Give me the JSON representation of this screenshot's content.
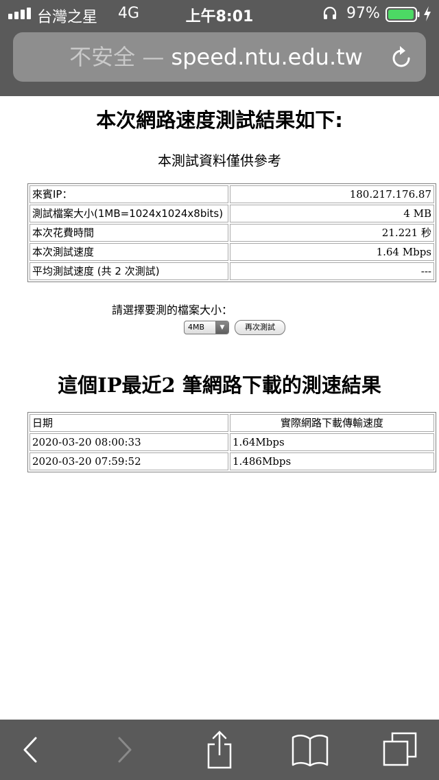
{
  "status_bar": {
    "carrier": "台灣之星",
    "network": "4G",
    "time": "上午8:01",
    "battery_percent": "97%",
    "battery_level": 0.97,
    "icons": [
      "signal-icon",
      "headphone-icon",
      "battery-icon",
      "charging-bolt-icon"
    ]
  },
  "url_bar": {
    "security_label": "不安全 —",
    "domain": "speed.ntu.edu.tw",
    "reload_icon": "reload-icon"
  },
  "page": {
    "title": "本次網路速度測試結果如下:",
    "subtitle": "本測試資料僅供參考",
    "results": [
      {
        "label": "來賓IP：",
        "value": "180.217.176.87"
      },
      {
        "label": "測試檔案大小(1MB=1024x1024x8bits)",
        "value": "4 MB"
      },
      {
        "label": "本次花費時間",
        "value": "21.221 秒"
      },
      {
        "label": "本次測試速度",
        "value": "1.64 Mbps"
      },
      {
        "label": "平均測試速度 (共 2 次測試)",
        "value": "---"
      }
    ],
    "select_label": "請選擇要測的檔案大小：",
    "select_value": "4MB",
    "retest_label": "再次測試",
    "history_title": "這個IP最近2 筆網路下載的測速結果",
    "history_headers": [
      "日期",
      "實際網路下載傳輸速度"
    ],
    "history_rows": [
      [
        "2020-03-20 08:00:33",
        "1.64Mbps"
      ],
      [
        "2020-03-20 07:59:52",
        "1.486Mbps"
      ]
    ]
  },
  "toolbar": {
    "icons": [
      "back-icon",
      "forward-icon",
      "share-icon",
      "bookmarks-icon",
      "tabs-icon"
    ]
  },
  "colors": {
    "chrome": "#5a5a5a",
    "url_bar": "#8e8e8e",
    "battery": "#4cd964"
  }
}
